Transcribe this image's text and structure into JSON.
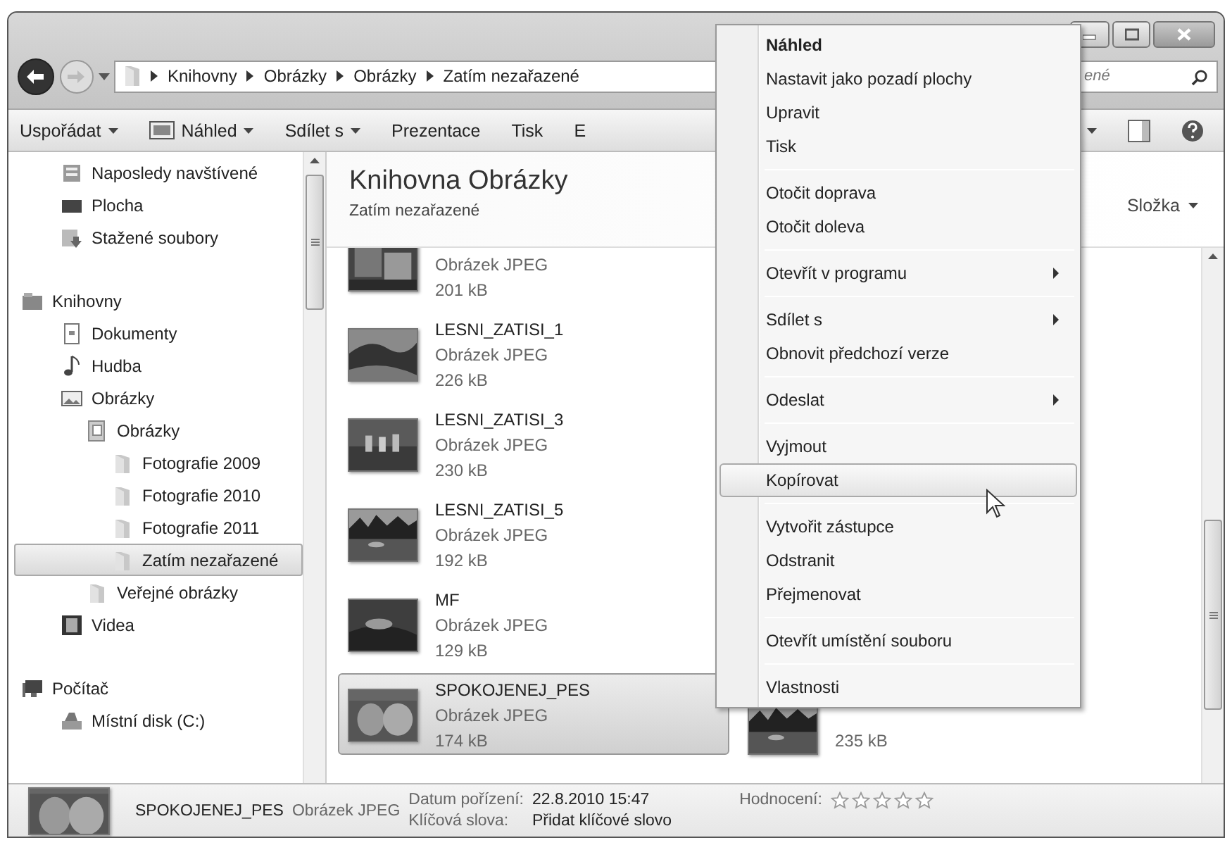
{
  "address_bar": {
    "segments": [
      "Knihovny",
      "Obrázky",
      "Obrázky",
      "Zatím nezařazené"
    ]
  },
  "search": {
    "placeholder": "ené"
  },
  "toolbar": {
    "items": [
      {
        "label": "Uspořádat",
        "dropdown": true
      },
      {
        "label": "Náhled",
        "dropdown": true
      },
      {
        "label": "Sdílet s",
        "dropdown": true
      },
      {
        "label": "Prezentace",
        "dropdown": false
      },
      {
        "label": "Tisk",
        "dropdown": false
      },
      {
        "label": "E",
        "dropdown": false
      }
    ]
  },
  "sidebar": {
    "groups": [
      {
        "children": [
          {
            "label": "Naposledy navštívené",
            "kind": "recent",
            "selected": false
          },
          {
            "label": "Plocha",
            "kind": "desktop",
            "selected": false
          },
          {
            "label": "Stažené soubory",
            "kind": "downloads",
            "selected": false
          }
        ]
      },
      {
        "label": "Knihovny",
        "kind": "libraries",
        "selected": false,
        "children": [
          {
            "label": "Dokumenty",
            "kind": "documents",
            "selected": false
          },
          {
            "label": "Hudba",
            "kind": "music",
            "selected": false
          },
          {
            "label": "Obrázky",
            "kind": "pictures",
            "selected": false,
            "children": [
              {
                "label": "Obrázky",
                "kind": "library-folder",
                "selected": false,
                "children": [
                  {
                    "label": "Fotografie 2009",
                    "kind": "folder",
                    "selected": false
                  },
                  {
                    "label": "Fotografie 2010",
                    "kind": "folder",
                    "selected": false
                  },
                  {
                    "label": "Fotografie 2011",
                    "kind": "folder",
                    "selected": false
                  },
                  {
                    "label": "Zatím nezařazené",
                    "kind": "folder",
                    "selected": true
                  }
                ]
              },
              {
                "label": "Veřejné obrázky",
                "kind": "folder",
                "selected": false
              }
            ]
          },
          {
            "label": "Videa",
            "kind": "videos",
            "selected": false
          }
        ]
      },
      {
        "label": "Počítač",
        "kind": "computer",
        "selected": false,
        "children": [
          {
            "label": "Místní disk (C:)",
            "kind": "disk",
            "selected": false
          }
        ]
      }
    ]
  },
  "content": {
    "title": "Knihovna Obrázky",
    "subtitle": "Zatím nezařazené",
    "arrange_by": "Složka",
    "files": [
      {
        "type": "Obrázek JPEG",
        "size": "201 kB",
        "selected": false
      },
      {
        "name": "LESNI_ZATISI_1",
        "type": "Obrázek JPEG",
        "size": "226 kB",
        "selected": false
      },
      {
        "name": "LESNI_ZATISI_3",
        "type": "Obrázek JPEG",
        "size": "230 kB",
        "selected": false
      },
      {
        "name": "LESNI_ZATISI_5",
        "type": "Obrázek JPEG",
        "size": "192 kB",
        "selected": false
      },
      {
        "name": "MF",
        "type": "Obrázek JPEG",
        "size": "129 kB",
        "selected": false
      },
      {
        "name": "SPOKOJENEJ_PES",
        "type": "Obrázek JPEG",
        "size": "174 kB",
        "selected": true
      }
    ],
    "second_column": [
      {
        "size": "235 kB",
        "selected": false
      }
    ]
  },
  "details": {
    "name": "SPOKOJENEJ_PES",
    "type": "Obrázek JPEG",
    "date_label": "Datum pořízení:",
    "date": "22.8.2010 15:47",
    "keywords_label": "Klíčová slova:",
    "keywords": "Přidat klíčové slovo",
    "rating_label": "Hodnocení:",
    "stars": 0
  },
  "context_menu": {
    "groups": [
      [
        {
          "label": "Náhled",
          "default": true,
          "submenu": false,
          "highlighted": false
        },
        {
          "label": "Nastavit jako pozadí plochy",
          "default": false,
          "submenu": false,
          "highlighted": false
        },
        {
          "label": "Upravit",
          "default": false,
          "submenu": false,
          "highlighted": false
        },
        {
          "label": "Tisk",
          "default": false,
          "submenu": false,
          "highlighted": false
        }
      ],
      [
        {
          "label": "Otočit doprava",
          "default": false,
          "submenu": false,
          "highlighted": false
        },
        {
          "label": "Otočit doleva",
          "default": false,
          "submenu": false,
          "highlighted": false
        }
      ],
      [
        {
          "label": "Otevřít v programu",
          "default": false,
          "submenu": true,
          "highlighted": false
        }
      ],
      [
        {
          "label": "Sdílet s",
          "default": false,
          "submenu": true,
          "highlighted": false
        },
        {
          "label": "Obnovit předchozí verze",
          "default": false,
          "submenu": false,
          "highlighted": false
        }
      ],
      [
        {
          "label": "Odeslat",
          "default": false,
          "submenu": true,
          "highlighted": false
        }
      ],
      [
        {
          "label": "Vyjmout",
          "default": false,
          "submenu": false,
          "highlighted": false
        },
        {
          "label": "Kopírovat",
          "default": false,
          "submenu": false,
          "highlighted": true
        }
      ],
      [
        {
          "label": "Vytvořit zástupce",
          "default": false,
          "submenu": false,
          "highlighted": false
        },
        {
          "label": "Odstranit",
          "default": false,
          "submenu": false,
          "highlighted": false
        },
        {
          "label": "Přejmenovat",
          "default": false,
          "submenu": false,
          "highlighted": false
        }
      ],
      [
        {
          "label": "Otevřít umístění souboru",
          "default": false,
          "submenu": false,
          "highlighted": false
        }
      ],
      [
        {
          "label": "Vlastnosti",
          "default": false,
          "submenu": false,
          "highlighted": false
        }
      ]
    ]
  }
}
